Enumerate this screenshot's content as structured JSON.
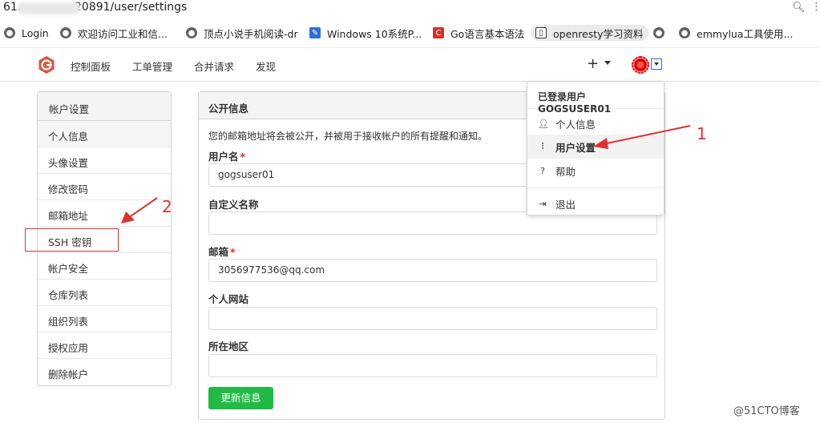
{
  "browser": {
    "url": "61.               20891/user/settings",
    "bookmarks": [
      {
        "label": "Login",
        "icon": "globe-icon"
      },
      {
        "label": "欢迎访问工业和信...",
        "icon": "globe-icon"
      },
      {
        "label": "顶点小说手机阅读-dr",
        "icon": "globe-icon"
      },
      {
        "label": "Windows 10系统P...",
        "icon": "pen-icon"
      },
      {
        "label": "Go语言基本语法",
        "icon": "c-icon"
      },
      {
        "label": "openresty学习资料",
        "icon": "book-icon"
      },
      {
        "label": "",
        "icon": "globe-icon"
      },
      {
        "label": "emmylua工具使用...",
        "icon": "globe-icon"
      }
    ]
  },
  "nav": {
    "items": [
      "控制面板",
      "工单管理",
      "合并请求",
      "发现"
    ],
    "plus": "+"
  },
  "sidebar": {
    "title": "帐户设置",
    "items": [
      "个人信息",
      "头像设置",
      "修改密码",
      "邮箱地址",
      "SSH 密钥",
      "帐户安全",
      "仓库列表",
      "组织列表",
      "授权应用",
      "删除帐户"
    ]
  },
  "panel": {
    "title": "公开信息",
    "notice": "您的邮箱地址将会被公开，并被用于接收帐户的所有提醒和通知。",
    "fields": [
      {
        "label": "用户名",
        "required": "*",
        "value": "gogsuser01"
      },
      {
        "label": "自定义名称",
        "required": "",
        "value": ""
      },
      {
        "label": "邮箱",
        "required": "*",
        "value": "3056977536@qq.com"
      },
      {
        "label": "个人网站",
        "required": "",
        "value": ""
      },
      {
        "label": "所在地区",
        "required": "",
        "value": ""
      }
    ],
    "submit": "更新信息"
  },
  "dropdown": {
    "header": "已登录用户 GOGSUSER01",
    "items": [
      {
        "label": "个人信息",
        "icon": "user-icon"
      },
      {
        "label": "用户设置",
        "icon": "sliders-icon"
      },
      {
        "label": "帮助",
        "icon": "help-icon"
      },
      {
        "label": "退出",
        "icon": "sign-out-icon"
      }
    ]
  },
  "annotations": {
    "one": "1",
    "two": "2"
  },
  "watermark": "@51CTO博客",
  "colors": {
    "green": "#21ba45",
    "annotation_red": "#e03131",
    "logo_red": "#e0533d"
  }
}
